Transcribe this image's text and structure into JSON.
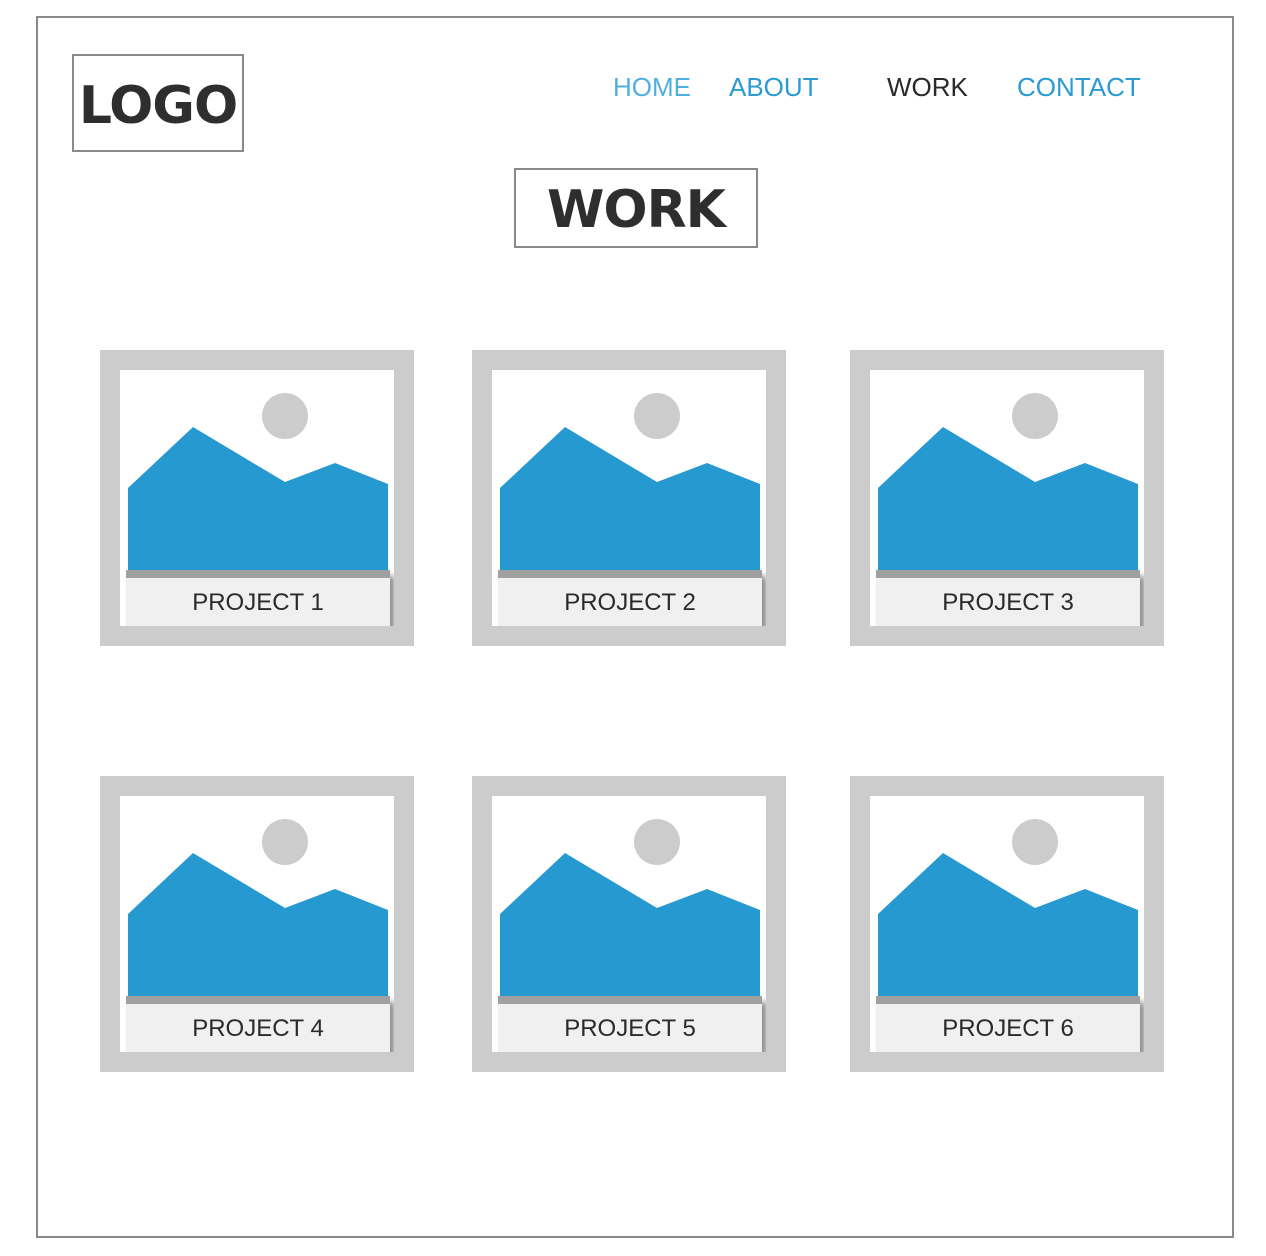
{
  "header": {
    "logo": "LOGO",
    "nav": [
      {
        "label": "HOME"
      },
      {
        "label": "ABOUT"
      },
      {
        "label": "WORK"
      },
      {
        "label": "CONTACT"
      }
    ]
  },
  "page": {
    "title": "WORK"
  },
  "projects": [
    {
      "label": "PROJECT 1",
      "icon": "image-placeholder-icon"
    },
    {
      "label": "PROJECT 2",
      "icon": "image-placeholder-icon"
    },
    {
      "label": "PROJECT 3",
      "icon": "image-placeholder-icon"
    },
    {
      "label": "PROJECT 4",
      "icon": "image-placeholder-icon"
    },
    {
      "label": "PROJECT 5",
      "icon": "image-placeholder-icon"
    },
    {
      "label": "PROJECT 6",
      "icon": "image-placeholder-icon"
    }
  ],
  "colors": {
    "accent": "#2699d1",
    "nav_link": "#2b9bd3",
    "nav_active": "#2a2a2a",
    "card_border": "#cccccc",
    "sun": "#cccccc"
  }
}
